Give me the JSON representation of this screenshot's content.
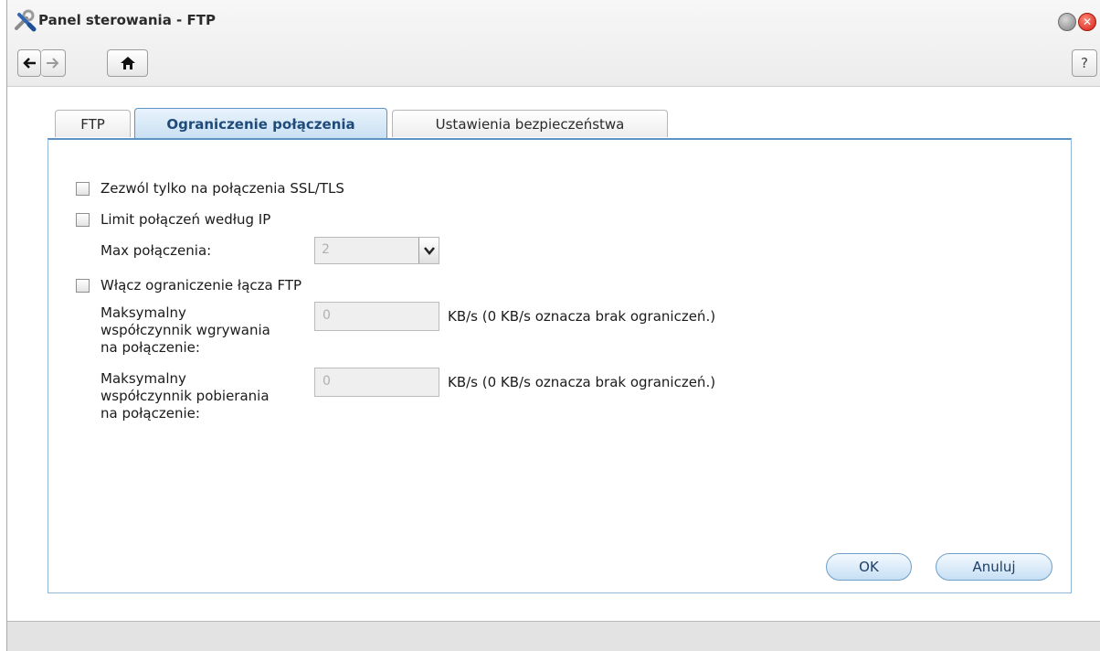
{
  "window": {
    "title": "Panel sterowania - FTP"
  },
  "toolbar": {
    "help_label": "?"
  },
  "tabs": [
    {
      "label": "FTP"
    },
    {
      "label": "Ograniczenie połączenia"
    },
    {
      "label": "Ustawienia bezpieczeństwa"
    }
  ],
  "form": {
    "ssl_only": {
      "label": "Zezwól tylko na połączenia SSL/TLS",
      "checked": false
    },
    "ip_limit": {
      "label": "Limit połączeń według IP",
      "checked": false
    },
    "max_conn": {
      "label": "Max połączenia:",
      "value": "2"
    },
    "ftp_limit": {
      "label": "Włącz ograniczenie łącza FTP",
      "checked": false
    },
    "upload": {
      "label_lines": [
        "Maksymalny",
        "współczynnik wgrywania",
        "na połączenie:"
      ],
      "value": "0",
      "unit": "KB/s (0 KB/s oznacza brak ograniczeń.)"
    },
    "download": {
      "label_lines": [
        "Maksymalny",
        "współczynnik pobierania",
        "na połączenie:"
      ],
      "value": "0",
      "unit": "KB/s (0 KB/s oznacza brak ograniczeń.)"
    }
  },
  "buttons": {
    "ok": "OK",
    "cancel": "Anuluj"
  },
  "colors": {
    "active_tab_border": "#5e93c3",
    "button_border": "#6f9fc9",
    "close": "#d21f12"
  }
}
